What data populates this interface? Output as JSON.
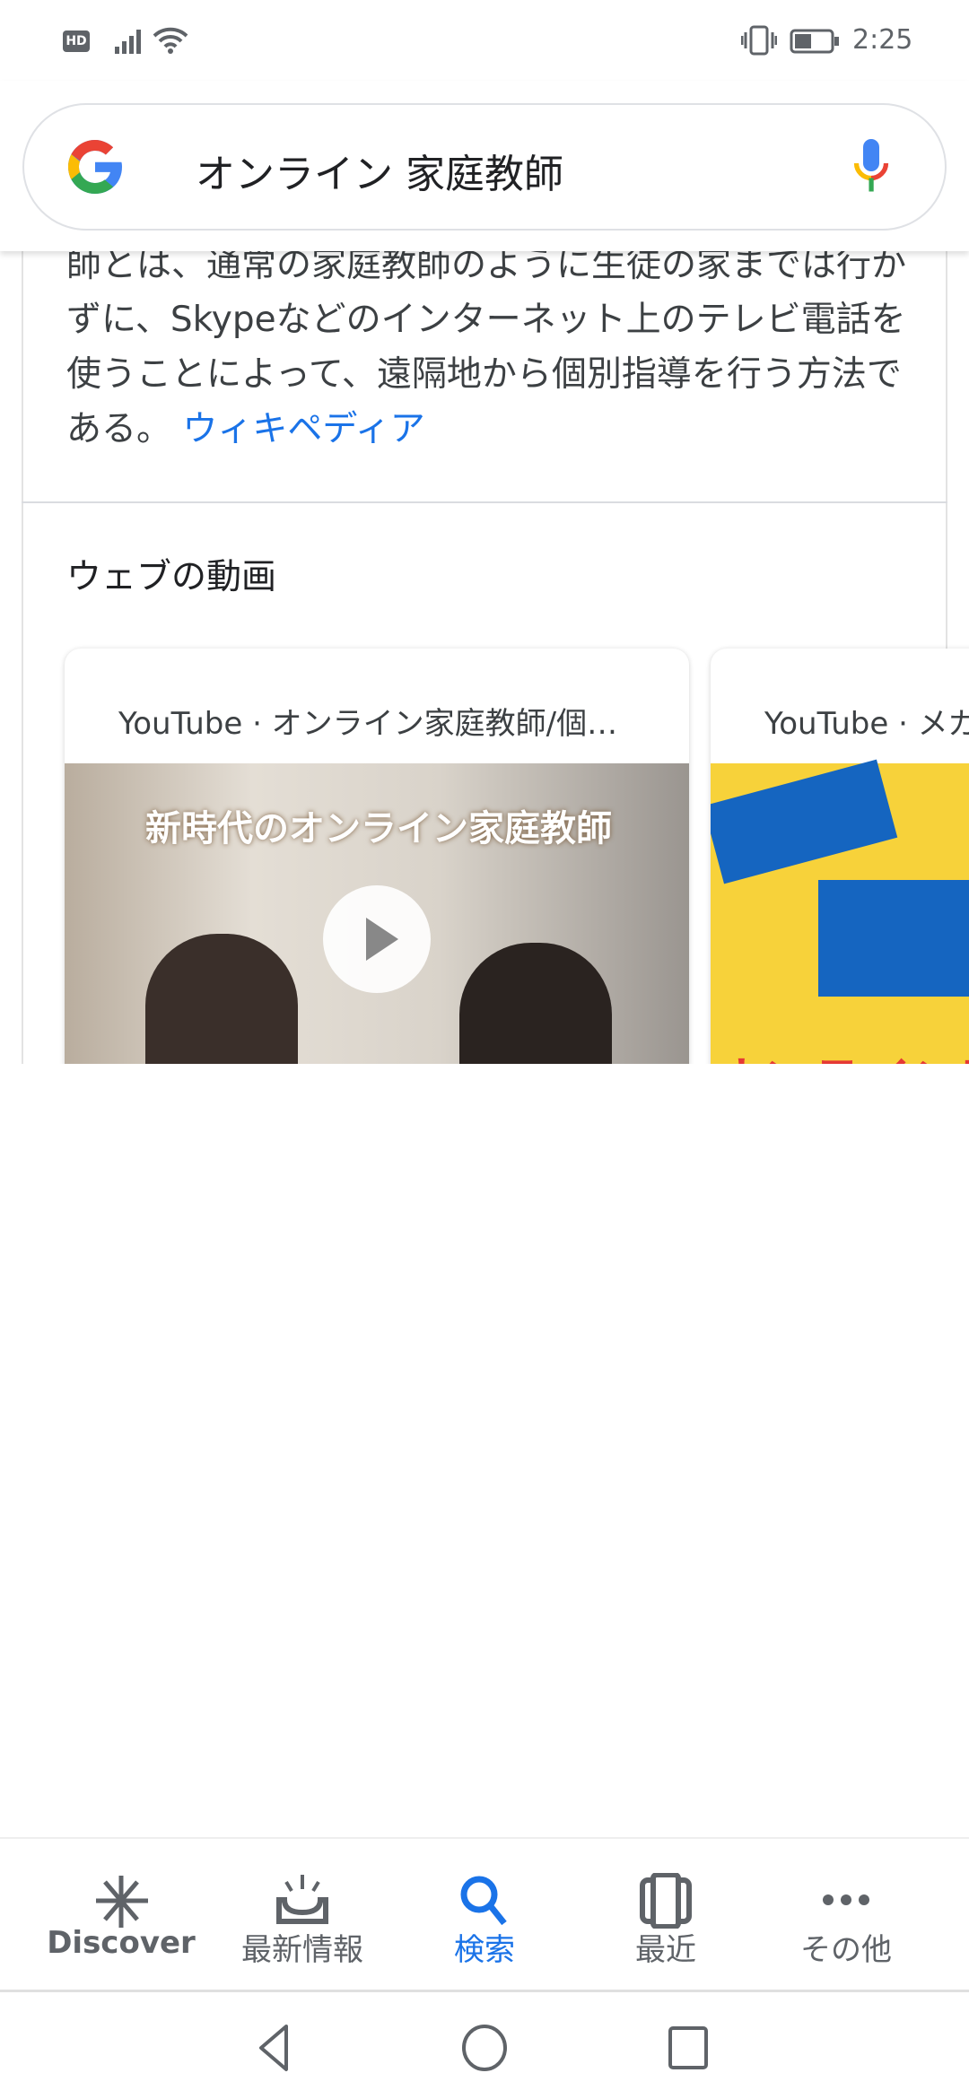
{
  "status_bar": {
    "time": "2:25",
    "hd_label": "HD"
  },
  "search": {
    "query": "オンライン 家庭教師"
  },
  "knowledge_panel": {
    "description": "師とは、通常の家庭教師のように生徒の家までは行かずに、Skypeなどのインターネット上のテレビ電話を使うことによって、遠隔地から個別指導を行う方法である。",
    "source_link": "ウィキペディア"
  },
  "videos": {
    "heading": "ウェブの動画",
    "items": [
      {
        "source": "YouTube · オンライン家庭教師/個…",
        "thumbnail_text": "新時代のオンライン家庭教師"
      },
      {
        "source": "YouTube · メガ",
        "thumbnail_text": "オンライン家"
      }
    ]
  },
  "bottom_nav": {
    "items": [
      {
        "label": "Discover",
        "icon": "asterisk-icon"
      },
      {
        "label": "最新情報",
        "icon": "inbox-updates-icon"
      },
      {
        "label": "検索",
        "icon": "search-icon",
        "active": true
      },
      {
        "label": "最近",
        "icon": "recent-cards-icon"
      },
      {
        "label": "その他",
        "icon": "more-icon"
      }
    ],
    "active_color": "#1a73e8"
  }
}
